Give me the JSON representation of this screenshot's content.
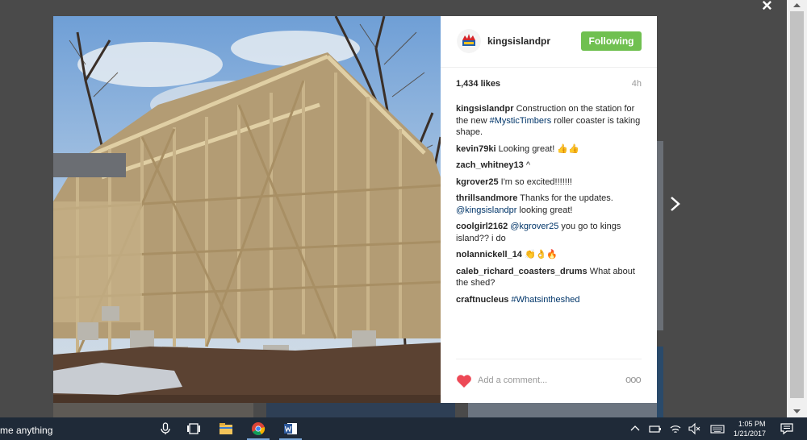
{
  "post": {
    "username": "kingsislandpr",
    "follow_label": "Following",
    "likes": "1,434 likes",
    "time": "4h",
    "add_comment_placeholder": "Add a comment...",
    "more": "ooo",
    "comments": [
      {
        "user": "kingsislandpr",
        "parts": [
          {
            "t": " Construction on the station for the new ",
            "tag": false
          },
          {
            "t": "#MysticTimbers",
            "tag": true
          },
          {
            "t": " roller coaster is taking shape.",
            "tag": false
          }
        ]
      },
      {
        "user": "kevin79ki",
        "parts": [
          {
            "t": " Looking great! 👍👍",
            "tag": false
          }
        ]
      },
      {
        "user": "zach_whitney13",
        "parts": [
          {
            "t": " ^",
            "tag": false
          }
        ]
      },
      {
        "user": "kgrover25",
        "parts": [
          {
            "t": " I'm so excited!!!!!!!",
            "tag": false
          }
        ]
      },
      {
        "user": "thrillsandmore",
        "parts": [
          {
            "t": " Thanks for the updates. ",
            "tag": false
          },
          {
            "t": "@kingsislandpr",
            "tag": true
          },
          {
            "t": " looking great!",
            "tag": false
          }
        ]
      },
      {
        "user": "coolgirl2162",
        "parts": [
          {
            "t": " ",
            "tag": false
          },
          {
            "t": "@kgrover25",
            "tag": true
          },
          {
            "t": " you go to kings island?? i do",
            "tag": false
          }
        ]
      },
      {
        "user": "nolannickell_14",
        "parts": [
          {
            "t": " 👏👌🔥",
            "tag": false
          }
        ]
      },
      {
        "user": "caleb_richard_coasters_drums",
        "parts": [
          {
            "t": " What about the shed?",
            "tag": false
          }
        ]
      },
      {
        "user": "craftnucleus",
        "parts": [
          {
            "t": " ",
            "tag": false
          },
          {
            "t": "#Whatsintheshed",
            "tag": true
          }
        ]
      }
    ]
  },
  "overlay": {
    "close_label": "×"
  },
  "taskbar": {
    "search_text": "me anything",
    "clock_time": "1:05 PM",
    "clock_date": "1/21/2017"
  },
  "colors": {
    "follow": "#70c050",
    "heart": "#ed4956",
    "link": "#003569"
  }
}
